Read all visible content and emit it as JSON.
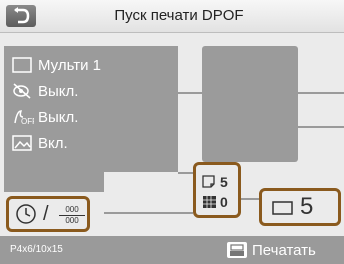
{
  "header": {
    "title": "Пуск печати DPOF"
  },
  "settings": {
    "layout_label": "Мульти 1",
    "redeye_label": "Выкл.",
    "off_label": "Выкл.",
    "correction_label": "Вкл."
  },
  "counts": {
    "copies_per_image": "5",
    "total_sheets": "0"
  },
  "copies": {
    "value": "5"
  },
  "timer": {
    "top": "000",
    "bottom": "000"
  },
  "footer": {
    "paper_size": "P4x6/10x15",
    "print_label": "Печатать"
  }
}
